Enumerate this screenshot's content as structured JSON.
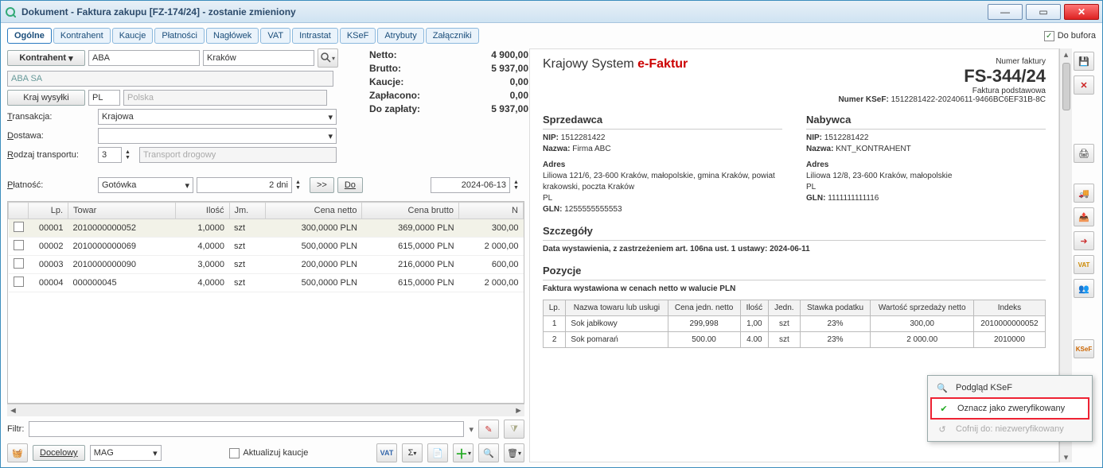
{
  "title": "Dokument - Faktura zakupu [FZ-174/24]  - zostanie zmieniony",
  "tabs": [
    "Ogólne",
    "Kontrahent",
    "Kaucje",
    "Płatności",
    "Nagłówek",
    "VAT",
    "Intrastat",
    "KSeF",
    "Atrybuty",
    "Załączniki"
  ],
  "doBufora": {
    "label": "Do bufora",
    "checked": true
  },
  "form": {
    "kontrahentBtn": "Kontrahent",
    "kontrahentCode": "ABA",
    "kontrahentCity": "Kraków",
    "kontrahentName": "ABA SA",
    "krajBtn": "Kraj wysyłki",
    "krajCode": "PL",
    "krajName": "Polska",
    "transakcjaLbl": "Transakcja:",
    "transakcjaVal": "Krajowa",
    "dostawaLbl": "Dostawa:",
    "dostawaVal": "",
    "rodzajLbl": "Rodzaj transportu:",
    "rodzajVal": "3",
    "rodzajDesc": "Transport drogowy",
    "platnoscLbl": "Płatność:",
    "platnoscVal": "Gotówka",
    "dniVal": "2 dni",
    "goBtn": ">>",
    "doBtn": "Do",
    "dateVal": "2024-06-13"
  },
  "totals": {
    "Netto": "4 900,00",
    "Brutto": "5 937,00",
    "Kaucje": "0,00",
    "Zapłacono": "0,00",
    "DoZaplaty": "5 937,00"
  },
  "gridCols": [
    "",
    "Lp.",
    "Towar",
    "Ilość",
    "Jm.",
    "Cena netto",
    "Cena brutto",
    "N"
  ],
  "gridRows": [
    {
      "lp": "00001",
      "towar": "2010000000052",
      "ilosc": "1,0000",
      "jm": "szt",
      "cn": "300,0000 PLN",
      "cb": "369,0000 PLN",
      "n": "300,00"
    },
    {
      "lp": "00002",
      "towar": "2010000000069",
      "ilosc": "4,0000",
      "jm": "szt",
      "cn": "500,0000 PLN",
      "cb": "615,0000 PLN",
      "n": "2 000,00"
    },
    {
      "lp": "00003",
      "towar": "2010000000090",
      "ilosc": "3,0000",
      "jm": "szt",
      "cn": "200,0000 PLN",
      "cb": "216,0000 PLN",
      "n": "600,00"
    },
    {
      "lp": "00004",
      "towar": "000000045",
      "ilosc": "4,0000",
      "jm": "szt",
      "cn": "500,0000 PLN",
      "cb": "615,0000 PLN",
      "n": "2 000,00"
    }
  ],
  "filtrLbl": "Filtr:",
  "aktualizujLbl": "Aktualizuj kaucje",
  "docelowyLbl": "Docelowy",
  "docelowyVal": "MAG",
  "preview": {
    "title_plain": "Krajowy System ",
    "title_red": "e-Faktur",
    "numerFakturyLbl": "Numer faktury",
    "numerFaktury": "FS-344/24",
    "typ": "Faktura podstawowa",
    "ksefLbl": "Numer KSeF:",
    "ksefVal": "1512281422-20240611-9466BC6EF31B-8C",
    "sprzedawcaH": "Sprzedawca",
    "nabywcaH": "Nabywca",
    "seller": {
      "nip": "1512281422",
      "nazwa": "Firma ABC",
      "adresH": "Adres",
      "adres": "Liliowa 121/6, 23-600 Kraków, małopolskie, gmina Kraków, powiat krakowski, poczta Kraków",
      "kraj": "PL",
      "gln": "1255555555553"
    },
    "buyer": {
      "nip": "1512281422",
      "nazwa": "KNT_KONTRAHENT",
      "adresH": "Adres",
      "adres": "Liliowa 12/8, 23-600 Kraków, małopolskie",
      "kraj": "PL",
      "gln": "1111111111116"
    },
    "szczegolyH": "Szczegóły",
    "szczegolyTxt": "Data wystawienia, z zastrzeżeniem art. 106na ust. 1 ustawy: 2024-06-11",
    "pozycjeH": "Pozycje",
    "pozycjeSub": "Faktura wystawiona w cenach netto w walucie PLN",
    "posCols": [
      "Lp.",
      "Nazwa towaru lub usługi",
      "Cena jedn. netto",
      "Ilość",
      "Jedn.",
      "Stawka podatku",
      "Wartość sprzedaży netto",
      "Indeks"
    ],
    "posRows": [
      {
        "lp": "1",
        "nazwa": "Sok jabłkowy",
        "cena": "299,998",
        "ilosc": "1,00",
        "jedn": "szt",
        "stawka": "23%",
        "wart": "300,00",
        "idx": "2010000000052"
      },
      {
        "lp": "2",
        "nazwa": "Sok pomarań",
        "cena": "500.00",
        "ilosc": "4.00",
        "jedn": "szt",
        "stawka": "23%",
        "wart": "2 000.00",
        "idx": "2010000"
      }
    ]
  },
  "ctx": {
    "i1": "Podgląd KSeF",
    "i2": "Oznacz jako zweryfikowany",
    "i3": "Cofnij do: niezweryfikowany"
  }
}
